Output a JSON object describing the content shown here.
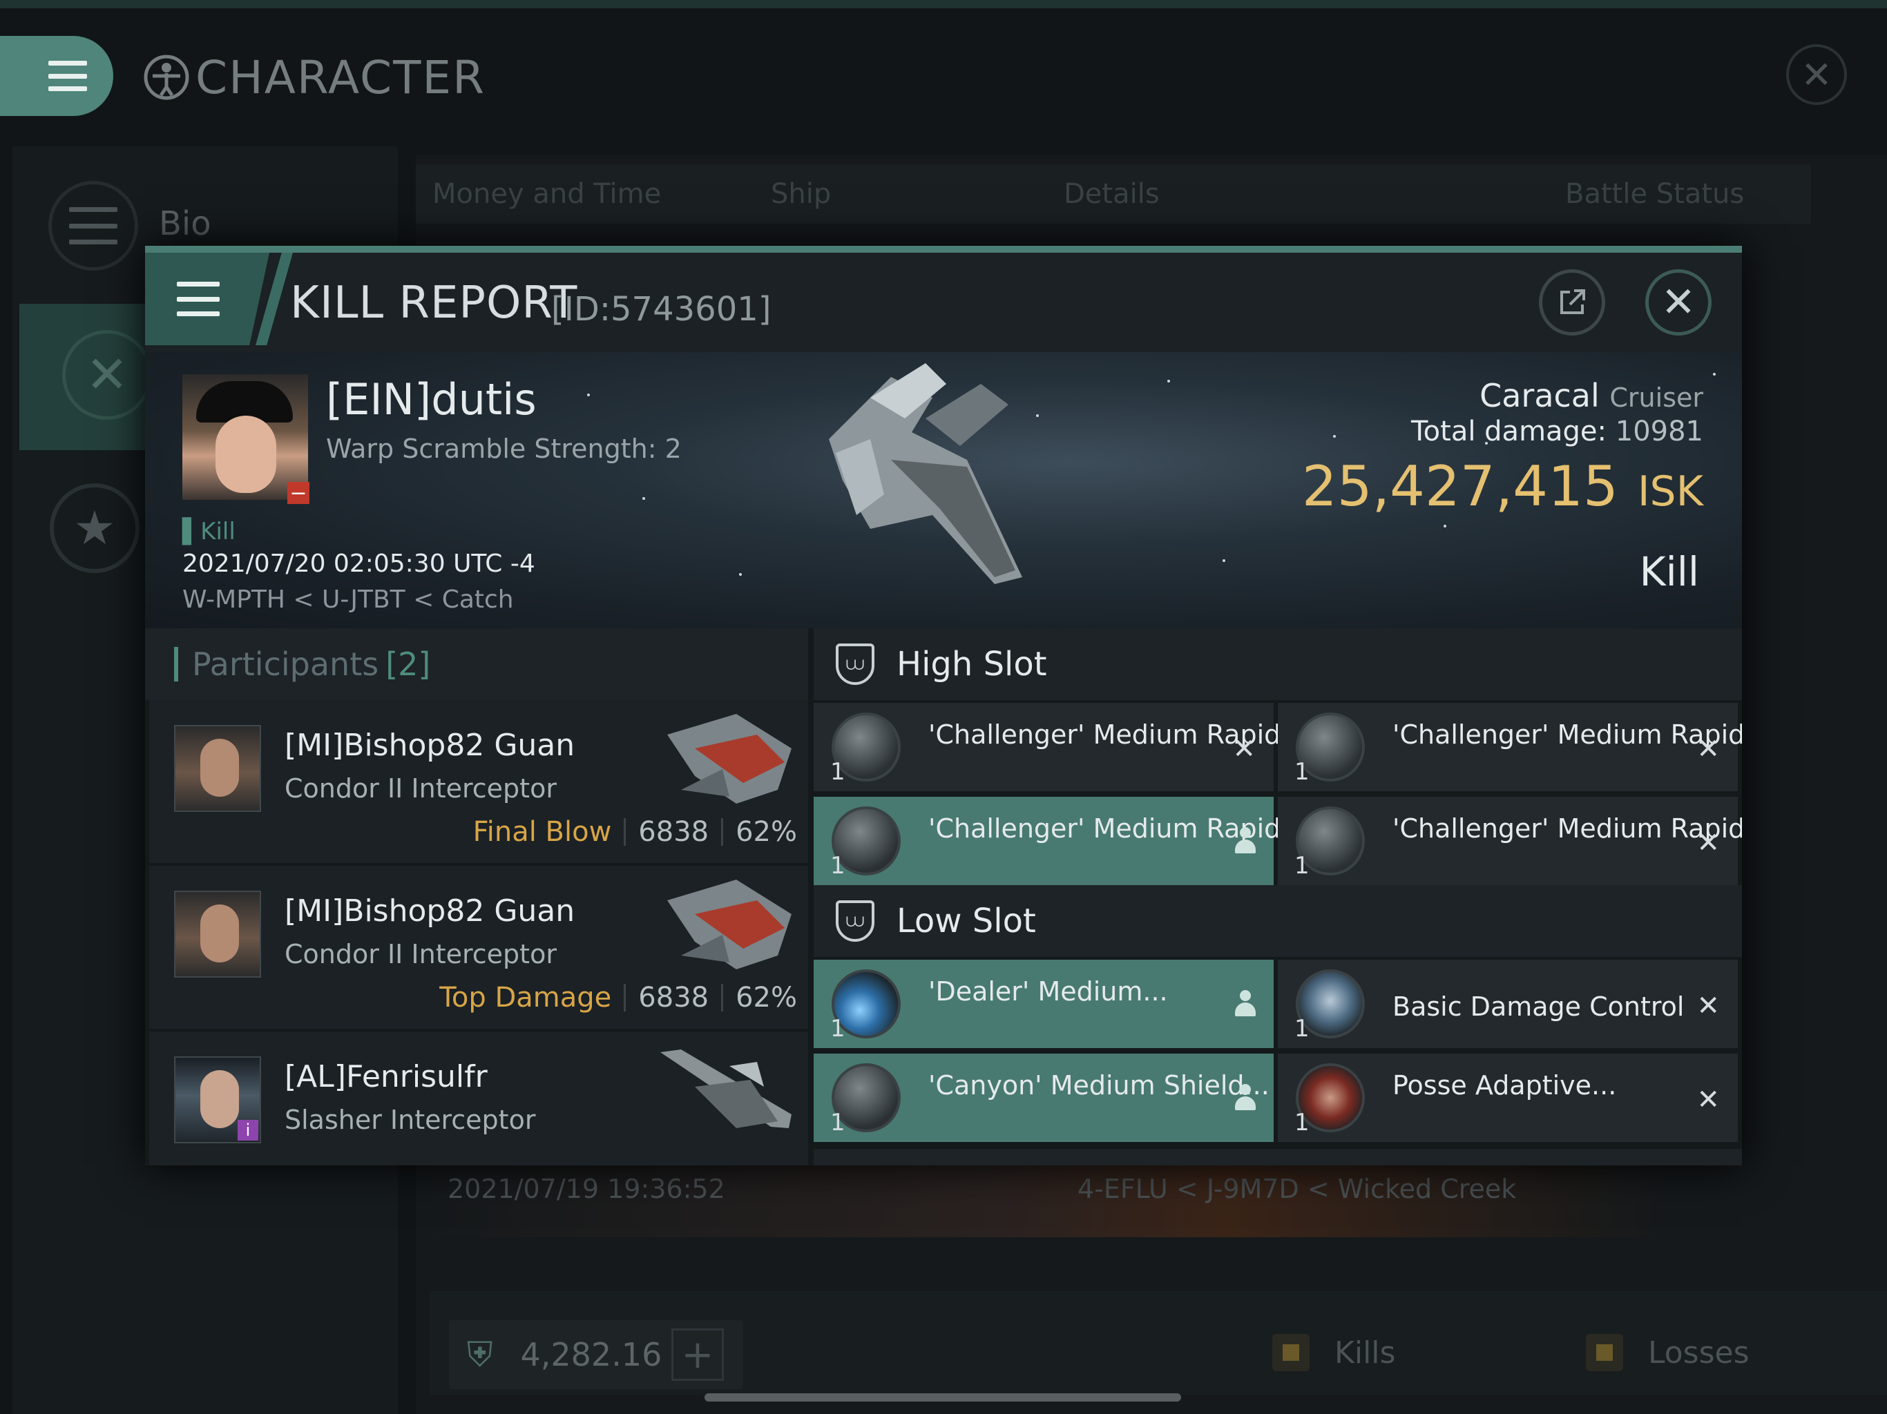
{
  "window": {
    "title": "CHARACTER",
    "close_label": "✕"
  },
  "sidebar": {
    "items": [
      {
        "label": "Bio"
      }
    ]
  },
  "background_table": {
    "columns": [
      "Money and Time",
      "Ship",
      "Details",
      "Battle Status"
    ],
    "row": {
      "date": "2021/07/19  19:36:52",
      "location": "4-EFLU < J-9M7D < Wicked Creek"
    }
  },
  "wallet": {
    "value": "4,282.16",
    "plus_label": "+"
  },
  "legend": {
    "kills": "Kills",
    "losses": "Losses",
    "kills_color": "#6a5a2a"
  },
  "kill_report": {
    "title": "KILL REPORT",
    "id": "[ID:5743601]",
    "victim": {
      "name": "[EIN]dutis",
      "warp": "Warp Scramble Strength: 2",
      "status": "Kill",
      "datetime": "2021/07/20 02:05:30 UTC -4",
      "location": "W-MPTH < U-JTBT < Catch"
    },
    "ship": {
      "name": "Caracal",
      "class": "Cruiser",
      "total_damage_label": "Total damage:",
      "total_damage": "10981"
    },
    "isk": {
      "value": "25,427,415",
      "unit": "ISK"
    },
    "result": "Kill",
    "participants": {
      "label": "Participants",
      "count": "[2]",
      "items": [
        {
          "name": "[MI]Bishop82 Guan",
          "ship": "Condor II Interceptor",
          "tag": "Final Blow",
          "damage": "6838",
          "percent": "62%"
        },
        {
          "name": "[MI]Bishop82 Guan",
          "ship": "Condor II Interceptor",
          "tag": "Top Damage",
          "damage": "6838",
          "percent": "62%"
        },
        {
          "name": "[AL]Fenrisulfr",
          "ship": "Slasher Interceptor",
          "badge": "i"
        }
      ]
    },
    "high_slot": {
      "title": "High Slot",
      "modules": [
        {
          "name": "'Challenger' Medium Rapid...",
          "qty": "1",
          "state": "✕"
        },
        {
          "name": "'Challenger' Medium Rapid...",
          "qty": "1",
          "state": "✕"
        },
        {
          "name": "'Challenger' Medium Rapid",
          "qty": "1"
        },
        {
          "name": "'Challenger' Medium Rapid...",
          "qty": "1",
          "state": "✕"
        }
      ]
    },
    "low_slot": {
      "title": "Low Slot",
      "modules": [
        {
          "name": "'Dealer' Medium...",
          "qty": "1"
        },
        {
          "name": "Basic Damage Control",
          "qty": "1",
          "state": "✕"
        },
        {
          "name": "'Canyon' Medium Shield...",
          "qty": "1"
        },
        {
          "name": "Posse Adaptive...",
          "qty": "1",
          "state": "✕"
        }
      ]
    },
    "colors": {
      "accent": "#4f8c7d",
      "isk": "#e4c070",
      "fitted": "#487a71",
      "final_blow": "#d8a548"
    }
  }
}
